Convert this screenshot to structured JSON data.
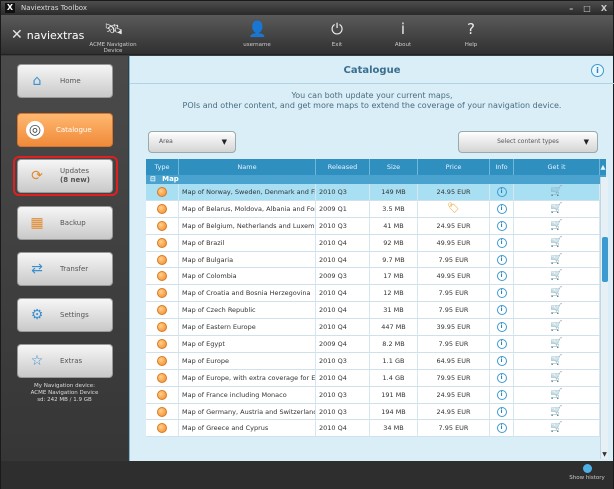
{
  "window": {
    "title": "Naviextras Toolbox",
    "controls": [
      "–",
      "□",
      "X"
    ]
  },
  "topbar": {
    "logo": "naviextras",
    "items": [
      {
        "label": "ACME Navigation Device",
        "icon": "satellite-icon"
      },
      {
        "label": "username",
        "icon": "user-icon"
      },
      {
        "label": "Exit",
        "icon": "power-icon"
      },
      {
        "label": "About",
        "icon": "info-icon"
      },
      {
        "label": "Help",
        "icon": "help-icon"
      }
    ]
  },
  "sidebar": {
    "items": [
      {
        "label": "Home",
        "icon": "home-icon"
      },
      {
        "label": "Catalogue",
        "icon": "catalogue-icon"
      },
      {
        "label": "Updates",
        "badge": "(8 new)",
        "icon": "updates-icon"
      },
      {
        "label": "Backup",
        "icon": "backup-icon"
      },
      {
        "label": "Transfer",
        "icon": "transfer-icon"
      },
      {
        "label": "Settings",
        "icon": "settings-icon"
      },
      {
        "label": "Extras",
        "icon": "extras-icon"
      }
    ],
    "device_info": {
      "line1": "My Navigation device:",
      "line2": "ACME Navigation Device",
      "line3": "sd: 242 MB / 1.9 GB"
    }
  },
  "main": {
    "title": "Catalogue",
    "subtitle_line1": "You can both update your current maps,",
    "subtitle_line2": "POIs and other content, and get more maps to extend the coverage of your navigation device.",
    "area_dropdown": "Area",
    "content_types_dropdown": "Select content types"
  },
  "table": {
    "columns": [
      "Type",
      "Name",
      "Released",
      "Size",
      "Price",
      "Info",
      "Get it"
    ],
    "group": "Map",
    "rows": [
      {
        "name": "Map of  Norway, Sweden, Denmark and Finla...",
        "released": "2010 Q3",
        "size": "149 MB",
        "price": "24.95 EUR",
        "selected": true
      },
      {
        "name": "Map of Belarus, Moldova, Albania and Former...",
        "released": "2009 Q1",
        "size": "3.5 MB",
        "price": "",
        "price_icon": "tag-icon"
      },
      {
        "name": "Map of Belgium, Netherlands and Luxembourg",
        "released": "2010 Q3",
        "size": "41 MB",
        "price": "24.95 EUR"
      },
      {
        "name": "Map of Brazil",
        "released": "2010 Q4",
        "size": "92 MB",
        "price": "49.95 EUR"
      },
      {
        "name": "Map of Bulgaria",
        "released": "2010 Q4",
        "size": "9.7 MB",
        "price": "7.95 EUR"
      },
      {
        "name": "Map of Colombia",
        "released": "2009 Q3",
        "size": "17 MB",
        "price": "49.95 EUR"
      },
      {
        "name": "Map of Croatia and Bosnia Herzegovina",
        "released": "2010 Q4",
        "size": "12 MB",
        "price": "7.95 EUR"
      },
      {
        "name": "Map of Czech Republic",
        "released": "2010 Q4",
        "size": "31 MB",
        "price": "7.95 EUR"
      },
      {
        "name": "Map of Eastern Europe",
        "released": "2010 Q4",
        "size": "447 MB",
        "price": "39.95 EUR"
      },
      {
        "name": "Map of Egypt",
        "released": "2009 Q4",
        "size": "8.2 MB",
        "price": "7.95 EUR"
      },
      {
        "name": "Map of Europe",
        "released": "2010 Q3",
        "size": "1.1 GB",
        "price": "64.95 EUR"
      },
      {
        "name": "Map of Europe, with extra coverage for East...",
        "released": "2010 Q4",
        "size": "1.4 GB",
        "price": "79.95 EUR"
      },
      {
        "name": "Map of France including Monaco",
        "released": "2010 Q3",
        "size": "191 MB",
        "price": "24.95 EUR"
      },
      {
        "name": "Map of Germany, Austria and Switzerland, in...",
        "released": "2010 Q3",
        "size": "194 MB",
        "price": "24.95 EUR"
      },
      {
        "name": "Map of Greece and Cyprus",
        "released": "2010 Q4",
        "size": "34 MB",
        "price": "7.95 EUR"
      }
    ]
  },
  "statusbar": {
    "history_label": "Show history"
  },
  "colors": {
    "accent": "#f08a3a",
    "table_header": "#2f8fbf",
    "highlight": "#e02020",
    "selected_row": "#a9dff2"
  }
}
